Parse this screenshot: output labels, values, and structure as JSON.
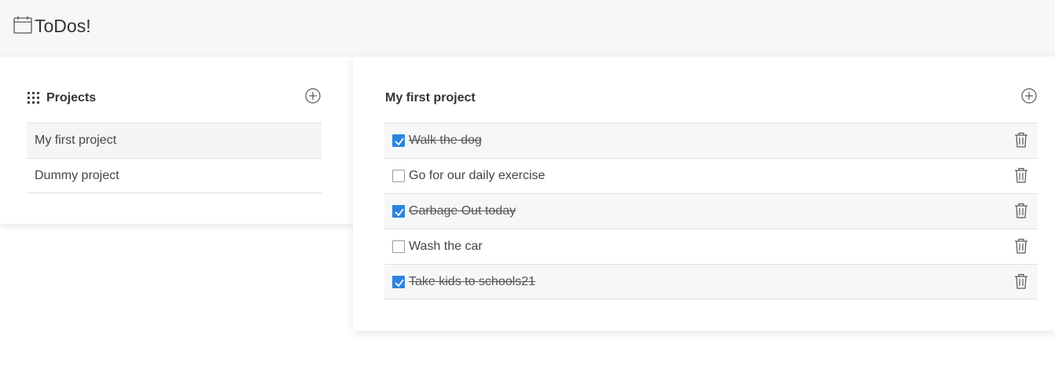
{
  "app": {
    "title": "ToDos!",
    "icon": "calendar-icon"
  },
  "projects_panel": {
    "title": "Projects",
    "title_icon": "grid-icon",
    "add_icon": "add-circle-icon",
    "items": [
      {
        "label": "My first project",
        "selected": true
      },
      {
        "label": "Dummy project",
        "selected": false
      }
    ]
  },
  "todos_panel": {
    "title": "My first project",
    "add_icon": "add-circle-icon",
    "delete_icon": "trash-icon",
    "items": [
      {
        "text": "Walk the dog",
        "done": true
      },
      {
        "text": "Go for our daily exercise",
        "done": false
      },
      {
        "text": "Garbage Out today",
        "done": true
      },
      {
        "text": "Wash the car",
        "done": false
      },
      {
        "text": "Take kids to schools21",
        "done": true
      }
    ]
  },
  "colors": {
    "header_bg": "#f7f7f7",
    "checkbox_checked": "#2b84e0",
    "selected_row": "#f5f5f5"
  }
}
